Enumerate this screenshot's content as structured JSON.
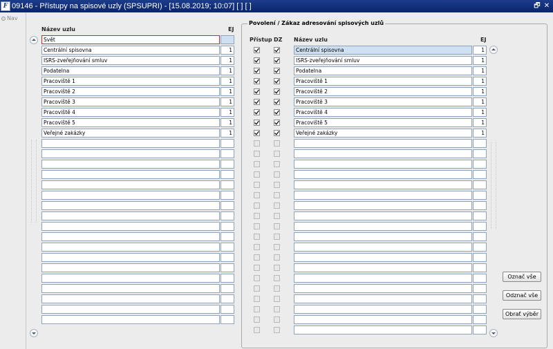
{
  "window": {
    "title": "09146 - Přístupy na spisové uzly (SPSUPRI) - [15.08.2019; 10:07]  [ ]  [ ]",
    "app_icon_letter": "F",
    "restore_glyph": "🗗",
    "close_glyph": "✕"
  },
  "nav": {
    "label": "Nav"
  },
  "left_table": {
    "col_name": "Název uzlu",
    "col_ej": "EJ",
    "current_input": "Svět",
    "rows": [
      {
        "name": "Centrální spisovna",
        "ej": "1"
      },
      {
        "name": "ISRS-zveřejňování smluv",
        "ej": "1"
      },
      {
        "name": "Podatelna",
        "ej": "1"
      },
      {
        "name": "Pracoviště 1",
        "ej": "1"
      },
      {
        "name": "Pracoviště 2",
        "ej": "1"
      },
      {
        "name": "Pracoviště 3",
        "ej": "1"
      },
      {
        "name": "Pracoviště 4",
        "ej": "1"
      },
      {
        "name": "Pracoviště 5",
        "ej": "1"
      },
      {
        "name": "Veřejné zakázky",
        "ej": "1"
      }
    ],
    "total_rows": 28
  },
  "right_group": {
    "title": "Povolení / Zákaz adresování spisových uzlů",
    "col_pristup": "Přístup",
    "col_dz": "DZ",
    "col_name": "Název uzlu",
    "col_ej": "EJ",
    "rows": [
      {
        "pristup": true,
        "dz": true,
        "name": "Centrální spisovna",
        "ej": "1"
      },
      {
        "pristup": true,
        "dz": true,
        "name": "ISRS-zveřejňování smluv",
        "ej": "1"
      },
      {
        "pristup": true,
        "dz": true,
        "name": "Podatelna",
        "ej": "1"
      },
      {
        "pristup": true,
        "dz": true,
        "name": "Pracoviště 1",
        "ej": "1"
      },
      {
        "pristup": true,
        "dz": true,
        "name": "Pracoviště 2",
        "ej": "1"
      },
      {
        "pristup": true,
        "dz": true,
        "name": "Pracoviště 3",
        "ej": "1"
      },
      {
        "pristup": true,
        "dz": true,
        "name": "Pracoviště 4",
        "ej": "1"
      },
      {
        "pristup": true,
        "dz": true,
        "name": "Pracoviště 5",
        "ej": "1"
      },
      {
        "pristup": true,
        "dz": true,
        "name": "Veřejné zakázky",
        "ej": "1"
      }
    ],
    "total_rows": 28
  },
  "buttons": {
    "select_all": "Označ vše",
    "deselect_all": "Odznač vše",
    "invert": "Obrať výběr"
  },
  "colors": {
    "title_bar": "#0a246a",
    "selected_cell": "#cfe0f3",
    "input_focus_border": "#dd2222"
  }
}
